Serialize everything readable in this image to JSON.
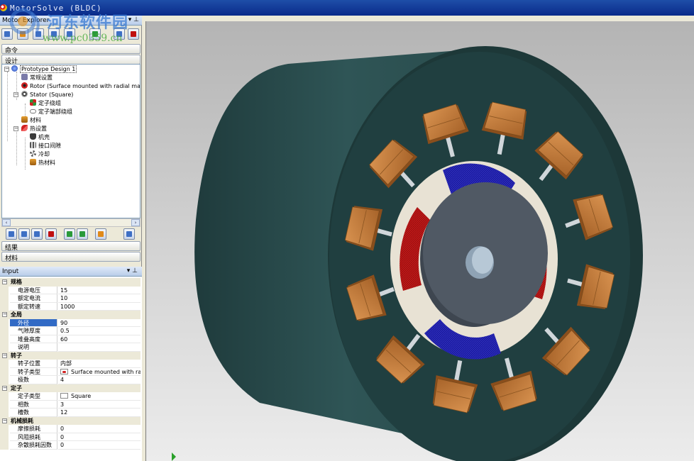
{
  "window": {
    "title": "MotorSolve (BLDC)"
  },
  "watermark": {
    "line1": "河东软件园",
    "line2": "www.pc0359.cn"
  },
  "explorer": {
    "title": "Motor Explorer",
    "pin": "▾ ⊥",
    "sections_top": [
      "命令",
      "设计"
    ],
    "tree": [
      {
        "label": "Prototype Design 1",
        "icon": "design-globe-icon"
      },
      {
        "label": "常规设置",
        "icon": "general-settings-icon"
      },
      {
        "label": "Rotor (Surface mounted with radial magnets)",
        "icon": "rotor-icon"
      },
      {
        "label": "Stator (Square)",
        "icon": "stator-icon"
      },
      {
        "label": "定子绕组",
        "icon": "stator-winding-icon"
      },
      {
        "label": "定子端部绕组",
        "icon": "end-winding-icon"
      },
      {
        "label": "材料",
        "icon": "materials-icon"
      },
      {
        "label": "热设置",
        "icon": "thermal-settings-icon"
      },
      {
        "label": "机壳",
        "icon": "housing-icon"
      },
      {
        "label": "接口间隙",
        "icon": "interface-gap-icon"
      },
      {
        "label": "冷却",
        "icon": "cooling-icon"
      },
      {
        "label": "热材料",
        "icon": "thermal-materials-icon"
      }
    ],
    "sections_bottom": [
      "结果",
      "材料"
    ]
  },
  "input": {
    "title": "Input",
    "pin": "▾ ⊥",
    "categories": [
      {
        "name": "规格",
        "rows": [
          {
            "key": "电源电压",
            "value": "15"
          },
          {
            "key": "额定电流",
            "value": "10"
          },
          {
            "key": "额定转速",
            "value": "1000"
          }
        ]
      },
      {
        "name": "全局",
        "rows": [
          {
            "key": "外径",
            "value": "90"
          },
          {
            "key": "气隙厚度",
            "value": "0.5"
          },
          {
            "key": "堆叠高度",
            "value": "60"
          },
          {
            "key": "说明",
            "value": ""
          }
        ]
      },
      {
        "name": "转子",
        "rows": [
          {
            "key": "转子位置",
            "value": "内部"
          },
          {
            "key": "转子类型",
            "value": "Surface mounted with ra..."
          },
          {
            "key": "极数",
            "value": "4"
          }
        ]
      },
      {
        "name": "定子",
        "rows": [
          {
            "key": "定子类型",
            "value": "Square"
          },
          {
            "key": "相数",
            "value": "3"
          },
          {
            "key": "槽数",
            "value": "12"
          }
        ]
      },
      {
        "name": "机械损耗",
        "rows": [
          {
            "key": "摩擦损耗",
            "value": "0"
          },
          {
            "key": "风阻损耗",
            "value": "0"
          },
          {
            "key": "杂散损耗因数",
            "value": "0"
          }
        ]
      }
    ]
  },
  "colors": {
    "housing": "#2c4e4f",
    "stator_coil": "#c8823e",
    "magnet_red": "#c01818",
    "magnet_blue": "#1a1aa0",
    "rotor_core": "#4f5763",
    "selection": "#316ac5"
  }
}
